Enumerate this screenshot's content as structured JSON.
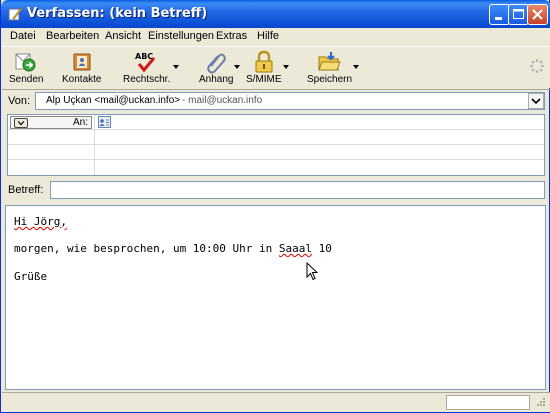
{
  "window": {
    "title": "Verfassen: (kein Betreff)"
  },
  "menu": {
    "items": [
      {
        "label": "Datei"
      },
      {
        "label": "Bearbeiten"
      },
      {
        "label": "Ansicht"
      },
      {
        "label": "Einstellungen"
      },
      {
        "label": "Extras"
      },
      {
        "label": "Hilfe"
      }
    ]
  },
  "toolbar": {
    "send": "Senden",
    "contacts": "Kontakte",
    "spelling": "Rechtschr.",
    "attach": "Anhang",
    "smime": "S/MIME",
    "save": "Speichern",
    "spelling_icon_text": "ABC"
  },
  "from": {
    "label": "Von:",
    "value": "Alp Uçkan <mail@uckan.info>",
    "hint": "- mail@uckan.info"
  },
  "recipients": {
    "type_label": "An:"
  },
  "subject": {
    "label": "Betreff:",
    "value": ""
  },
  "body": {
    "line1": "Hi Jörg,",
    "line2_pre": "morgen, wie besprochen, um 10:00 Uhr in ",
    "line2_err": "Saaal",
    "line2_post": " 10",
    "line3": "Grüße"
  },
  "colors": {
    "titlebar": "#0b4fd5",
    "spellcheck_error": "#e00000",
    "window_bg": "#ece9d8"
  }
}
